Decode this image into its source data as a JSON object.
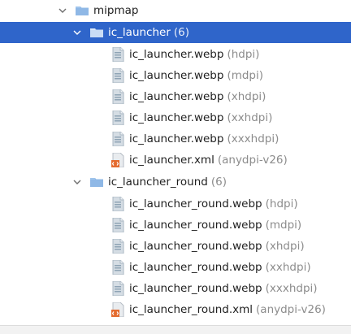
{
  "tree": {
    "mipmap": {
      "label": "mipmap"
    },
    "ic_launcher": {
      "label": "ic_launcher",
      "count": "(6)",
      "files": [
        {
          "name": "ic_launcher.webp",
          "qualifier": "(hdpi)",
          "kind": "webp"
        },
        {
          "name": "ic_launcher.webp",
          "qualifier": "(mdpi)",
          "kind": "webp"
        },
        {
          "name": "ic_launcher.webp",
          "qualifier": "(xhdpi)",
          "kind": "webp"
        },
        {
          "name": "ic_launcher.webp",
          "qualifier": "(xxhdpi)",
          "kind": "webp"
        },
        {
          "name": "ic_launcher.webp",
          "qualifier": "(xxxhdpi)",
          "kind": "webp"
        },
        {
          "name": "ic_launcher.xml",
          "qualifier": "(anydpi-v26)",
          "kind": "xml"
        }
      ]
    },
    "ic_launcher_round": {
      "label": "ic_launcher_round",
      "count": "(6)",
      "files": [
        {
          "name": "ic_launcher_round.webp",
          "qualifier": "(hdpi)",
          "kind": "webp"
        },
        {
          "name": "ic_launcher_round.webp",
          "qualifier": "(mdpi)",
          "kind": "webp"
        },
        {
          "name": "ic_launcher_round.webp",
          "qualifier": "(xhdpi)",
          "kind": "webp"
        },
        {
          "name": "ic_launcher_round.webp",
          "qualifier": "(xxhdpi)",
          "kind": "webp"
        },
        {
          "name": "ic_launcher_round.webp",
          "qualifier": "(xxxhdpi)",
          "kind": "webp"
        },
        {
          "name": "ic_launcher_round.xml",
          "qualifier": "(anydpi-v26)",
          "kind": "xml"
        }
      ]
    }
  },
  "colors": {
    "selection": "#2f65ca",
    "folder": "#8fb8e6",
    "qualifier": "#8c8c8c"
  },
  "icons": {
    "expanded": "chevron-down-icon",
    "folder": "folder-icon",
    "webp_file": "image-file-icon",
    "xml_file": "xml-file-icon"
  }
}
